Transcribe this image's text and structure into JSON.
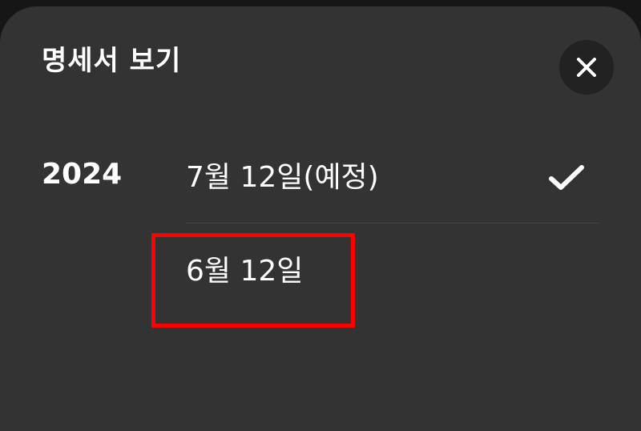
{
  "sheet": {
    "title": "명세서 보기",
    "close_icon": "close-icon"
  },
  "statements": {
    "year": "2024",
    "items": [
      {
        "label": "7월 12일(예정)",
        "selected": true,
        "check_icon": "checkmark-icon"
      },
      {
        "label": "6월 12일",
        "selected": false
      }
    ]
  },
  "annotation": {
    "highlight_color": "#ff0000"
  },
  "colors": {
    "sheet_background": "#333333",
    "close_button_background": "#222222",
    "text": "#ffffff"
  }
}
